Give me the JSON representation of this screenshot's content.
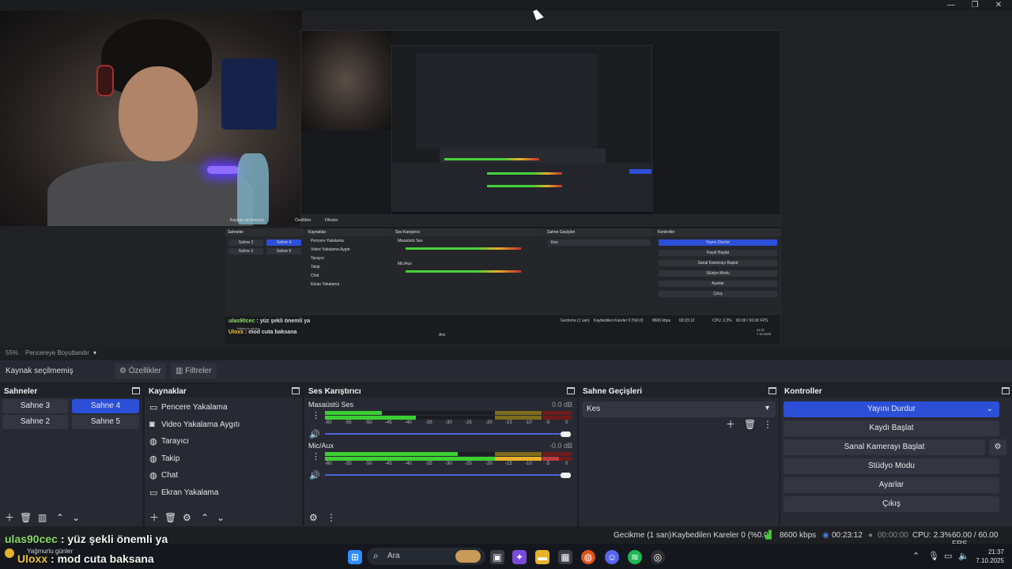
{
  "window": {
    "minimize": "—",
    "maximize": "❐",
    "close": "✕"
  },
  "nested": {
    "source_label": "Kaynak seçilmemiş",
    "props": "Özellikler",
    "filters": "Filtreler",
    "docks": {
      "scenes": "Sahneler",
      "sources": "Kaynaklar",
      "mixer": "Ses Karıştırıcı",
      "transitions": "Sahne Geçişleri",
      "controls": "Kontroller"
    },
    "scenes": [
      "Sahne 3",
      "Sahne 4",
      "Sahne 2",
      "Sahne 5"
    ],
    "sources": [
      "Pencere Yakalama",
      "Video Yakalama Aygıtı",
      "Tarayıcı",
      "Takip",
      "Chat",
      "Ekran Yakalama"
    ],
    "mixer": {
      "desktop": "Masaüstü Ses",
      "mic": "Mic/Aux"
    },
    "transition": "Kes",
    "controls": [
      "Yayını Durdur",
      "Kaydı Başlat",
      "Sanal Kamerayı Başlat",
      "Stüdyo Modu",
      "Ayarlar",
      "Çıkış"
    ],
    "chat": [
      {
        "user": "ulas90cec",
        "msg": " : yüz şekli önemli ya"
      },
      {
        "user": "Uloxx",
        "msg": " : mod cuta baksana"
      }
    ],
    "status": {
      "delay": "Gecikme (1 san)",
      "dropped": "Kaybedilen Kareler 0 (%0.0)",
      "kbps": "8600 kbps",
      "time": "00:23:12",
      "cpu": "CPU: 2.3%",
      "fps": "60.00 / 60.00 FPS"
    },
    "weather": "Yağmurlu günler",
    "search": "Ara",
    "clock_time": "21:37",
    "clock_date": "7.10.2025"
  },
  "preview_bar": {
    "zoom": "55%",
    "mode": "Pencereye Boyutlandır"
  },
  "source_toolbar": {
    "selected": "Kaynak seçilmemiş",
    "properties": "Özellikler",
    "filters": "Filtreler"
  },
  "scenes_dock": {
    "title": "Sahneler",
    "scenes": [
      {
        "label": "Sahne 3",
        "active": false
      },
      {
        "label": "Sahne 4",
        "active": true
      },
      {
        "label": "Sahne 2",
        "active": false
      },
      {
        "label": "Sahne 5",
        "active": false
      }
    ]
  },
  "sources_dock": {
    "title": "Kaynaklar",
    "sources": [
      {
        "label": "Pencere Yakalama",
        "icon": "window-icon"
      },
      {
        "label": "Video Yakalama Aygıtı",
        "icon": "camera-icon"
      },
      {
        "label": "Tarayıcı",
        "icon": "globe-icon"
      },
      {
        "label": "Takip",
        "icon": "globe-icon"
      },
      {
        "label": "Chat",
        "icon": "globe-icon"
      },
      {
        "label": "Ekran Yakalama",
        "icon": "monitor-icon"
      }
    ]
  },
  "mixer_dock": {
    "title": "Ses Karıştırıcı",
    "ticks": [
      "-60",
      "-55",
      "-50",
      "-45",
      "-40",
      "-35",
      "-30",
      "-25",
      "-20",
      "-15",
      "-10",
      "-5",
      "0"
    ],
    "channels": [
      {
        "name": "Masaüstü Ses",
        "db": "0.0 dB",
        "level": 0.23,
        "volume": 1.0
      },
      {
        "name": "Mic/Aux",
        "db": "-0.0 dB",
        "level": 0.54,
        "volume": 1.0
      }
    ]
  },
  "transitions_dock": {
    "title": "Sahne Geçişleri",
    "transition": "Kes"
  },
  "controls_dock": {
    "title": "Kontroller",
    "stop_stream": "Yayını Durdur",
    "start_record": "Kaydı Başlat",
    "virtual_cam": "Sanal Kamerayı Başlat",
    "studio_mode": "Stüdyo Modu",
    "settings": "Ayarlar",
    "exit": "Çıkış"
  },
  "status": {
    "delay": "Gecikme (1 san)",
    "dropped": "Kaybedilen Kareler 0 (%0.0)",
    "kbps": "8600 kbps",
    "stream_time": "00:23:12",
    "rec_time": "00:00:00",
    "cpu": "CPU: 2.3%",
    "fps": "60.00 / 60.00 FPS"
  },
  "chat": {
    "line1_user": "ulas90cec",
    "line1_msg": " : yüz şekli önemli ya",
    "line2_user": "Uloxx",
    "line2_msg": " : mod cuta baksana"
  },
  "taskbar": {
    "weather": "Yağmurlu günler",
    "search": "Ara",
    "time": "21:37",
    "date": "7.10.2025"
  },
  "colors": {
    "accent": "#2c4fd8",
    "panel": "#272a33",
    "meter_green": "#3ccf33",
    "meter_yellow": "#e7b02b",
    "meter_red": "#c33a3a"
  }
}
